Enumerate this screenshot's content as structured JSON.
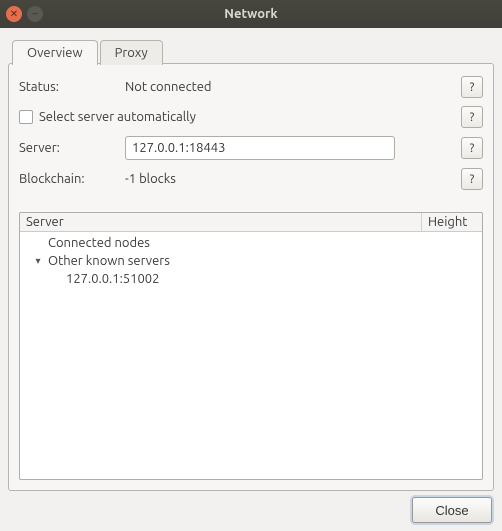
{
  "window": {
    "title": "Network"
  },
  "tabs": {
    "overview": "Overview",
    "proxy": "Proxy"
  },
  "overview": {
    "status_label": "Status:",
    "status_value": "Not connected",
    "auto_label": "Select server automatically",
    "auto_checked": false,
    "server_label": "Server:",
    "server_value": "127.0.0.1:18443",
    "blockchain_label": "Blockchain:",
    "blockchain_value": "-1 blocks",
    "help_glyph": "?"
  },
  "tree": {
    "header_server": "Server",
    "header_height": "Height",
    "connected_label": "Connected nodes",
    "other_label": "Other known servers",
    "other_children": [
      "127.0.0.1:51002"
    ]
  },
  "footer": {
    "close": "Close"
  }
}
